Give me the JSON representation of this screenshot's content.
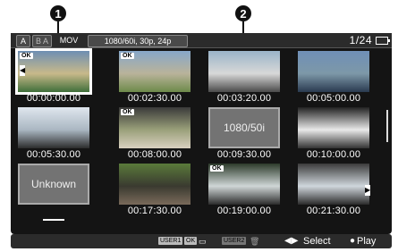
{
  "callouts": {
    "c1": "1",
    "c2": "2"
  },
  "topbar": {
    "tab1": "A",
    "tab2": "B A",
    "format": "MOV",
    "mode": "1080/60i, 30p, 24p",
    "page": "1/24"
  },
  "thumbnails": [
    {
      "badge": "OK",
      "time": "00:00:00.00",
      "selected": true,
      "status": "ok"
    },
    {
      "badge": "OK",
      "time": "00:02:30.00",
      "status": "ok"
    },
    {
      "badge": "",
      "time": "00:03:20.00",
      "status": "ok"
    },
    {
      "badge": "",
      "time": "00:05:00.00",
      "status": "ok"
    },
    {
      "badge": "",
      "time": "00:05:30.00",
      "status": "ok"
    },
    {
      "badge": "OK",
      "time": "00:08:00.00",
      "status": "ok"
    },
    {
      "badge": "",
      "time": "00:09:30.00",
      "status": "placeholder",
      "label": "1080/50i"
    },
    {
      "badge": "",
      "time": "00:10:00.00",
      "status": "ok"
    },
    {
      "badge": "",
      "time": "",
      "status": "placeholder",
      "label": "Unknown"
    },
    {
      "badge": "",
      "time": "00:17:30.00",
      "status": "ok"
    },
    {
      "badge": "OK",
      "time": "00:19:00.00",
      "status": "ok"
    },
    {
      "badge": "",
      "time": "00:21:30.00",
      "status": "ok"
    }
  ],
  "bottombar": {
    "user1": "USER1",
    "ok": "OK",
    "user2": "USER2",
    "select": "Select",
    "play": "Play"
  }
}
